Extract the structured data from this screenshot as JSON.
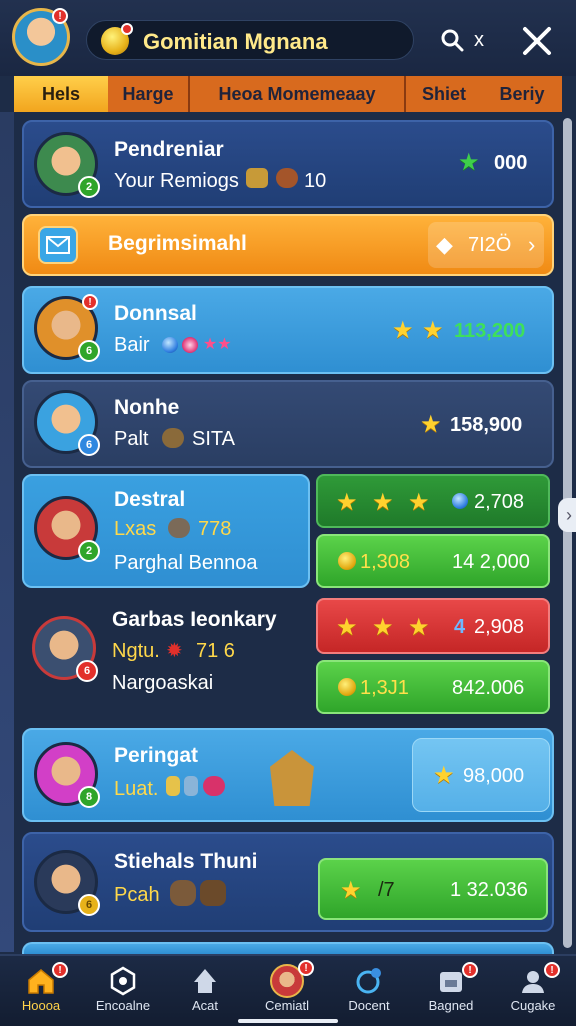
{
  "header": {
    "title": "Gomitian Mgnana",
    "avatar_badge": "!",
    "search_suffix": "x"
  },
  "tabs": [
    {
      "label": "Hels",
      "active": true
    },
    {
      "label": "Harge",
      "active": false
    },
    {
      "label": "Heoa  Momemeaay",
      "active": false
    },
    {
      "label": "Shiet",
      "active": false
    },
    {
      "label": "Beriy",
      "active": false
    }
  ],
  "player": {
    "name": "Pendreniar",
    "subtitle": "Your Remiogs",
    "items_count": "10",
    "score": "000",
    "badge": "2"
  },
  "banner": {
    "label": "Begrimsimahl",
    "value": "7I2Ö"
  },
  "rows": [
    {
      "name": "Donnsal",
      "sub": "Bair",
      "score": "113,200",
      "badge": "6"
    },
    {
      "name": "Nonhe",
      "sub": "Palt",
      "sub_extra": "SITA",
      "score": "158,900",
      "badge": "6"
    },
    {
      "name": "Destral",
      "line2_prefix": "Lxas",
      "line2_value": "778",
      "line3": "Parghal Bennoa",
      "badge": "2",
      "top_pill_value": "2,708",
      "bottom_pill_coin": "1,308",
      "bottom_pill_value": "14 2,000"
    },
    {
      "name": "Garbas Ieonkary",
      "line2_prefix": "Ngtu.",
      "line2_value": "71 6",
      "line3": "Nargoaskai",
      "badge": "6",
      "top_pill_value": "2,908",
      "top_pill_num": "4",
      "bottom_pill_coin": "1,3J1",
      "bottom_pill_value": "842.006"
    },
    {
      "name": "Peringat",
      "sub": "Luat.",
      "score": "98,000",
      "badge": "8"
    },
    {
      "name": "Stiehals Thuni",
      "sub": "Pcah",
      "pill_text": "/7",
      "pill_value": "1 32.036",
      "badge": "6"
    }
  ],
  "nav": [
    {
      "label": "Hoooa",
      "active": true,
      "badge": "!"
    },
    {
      "label": "Encoalne",
      "active": false
    },
    {
      "label": "Acat",
      "active": false
    },
    {
      "label": "Cemiatl",
      "active": false,
      "badge": "!"
    },
    {
      "label": "Docent",
      "active": false
    },
    {
      "label": "Bagned",
      "active": false,
      "badge": "!"
    },
    {
      "label": "Cugake",
      "active": false,
      "badge": "!"
    }
  ],
  "colors": {
    "accent_orange": "#f2a51e",
    "card_blue": "#2f8fd2",
    "pill_green": "#2fa52a",
    "pill_red": "#c52626",
    "title_gold": "#ffe98a"
  }
}
